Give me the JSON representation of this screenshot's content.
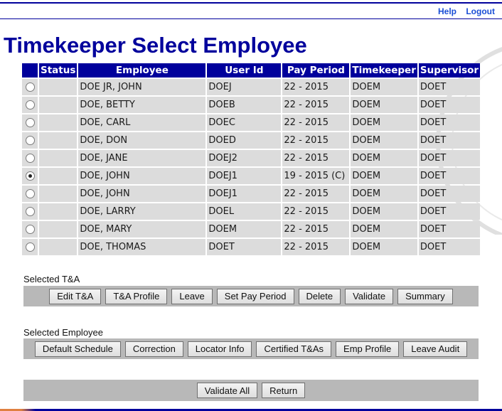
{
  "header": {
    "links": [
      {
        "label": "Help"
      },
      {
        "label": "Logout"
      }
    ],
    "title": "Timekeeper Select Employee"
  },
  "table": {
    "columns": [
      "",
      "Status",
      "Employee",
      "User Id",
      "Pay Period",
      "Timekeeper",
      "Supervisor"
    ],
    "rows": [
      {
        "selected": false,
        "status": "",
        "employee": "DOE JR, JOHN",
        "user_id": "DOEJ",
        "pay_period": "22 - 2015",
        "timekeeper": "DOEM",
        "supervisor": "DOET"
      },
      {
        "selected": false,
        "status": "",
        "employee": "DOE, BETTY",
        "user_id": "DOEB",
        "pay_period": "22 - 2015",
        "timekeeper": "DOEM",
        "supervisor": "DOET"
      },
      {
        "selected": false,
        "status": "",
        "employee": "DOE, CARL",
        "user_id": "DOEC",
        "pay_period": "22 - 2015",
        "timekeeper": "DOEM",
        "supervisor": "DOET"
      },
      {
        "selected": false,
        "status": "",
        "employee": "DOE, DON",
        "user_id": "DOED",
        "pay_period": "22 - 2015",
        "timekeeper": "DOEM",
        "supervisor": "DOET"
      },
      {
        "selected": false,
        "status": "",
        "employee": "DOE, JANE",
        "user_id": "DOEJ2",
        "pay_period": "22 - 2015",
        "timekeeper": "DOEM",
        "supervisor": "DOET"
      },
      {
        "selected": true,
        "status": "",
        "employee": "DOE, JOHN",
        "user_id": "DOEJ1",
        "pay_period": "19 - 2015 (C)",
        "timekeeper": "DOEM",
        "supervisor": "DOET"
      },
      {
        "selected": false,
        "status": "",
        "employee": "DOE, JOHN",
        "user_id": "DOEJ1",
        "pay_period": "22 - 2015",
        "timekeeper": "DOEM",
        "supervisor": "DOET"
      },
      {
        "selected": false,
        "status": "",
        "employee": "DOE, LARRY",
        "user_id": "DOEL",
        "pay_period": "22 - 2015",
        "timekeeper": "DOEM",
        "supervisor": "DOET"
      },
      {
        "selected": false,
        "status": "",
        "employee": "DOE, MARY",
        "user_id": "DOEM",
        "pay_period": "22 - 2015",
        "timekeeper": "DOEM",
        "supervisor": "DOET"
      },
      {
        "selected": false,
        "status": "",
        "employee": "DOE, THOMAS",
        "user_id": "DOET",
        "pay_period": "22 - 2015",
        "timekeeper": "DOEM",
        "supervisor": "DOET"
      }
    ]
  },
  "selected_ta": {
    "label": "Selected T&A",
    "buttons": [
      "Edit T&A",
      "T&A Profile",
      "Leave",
      "Set Pay Period",
      "Delete",
      "Validate",
      "Summary"
    ]
  },
  "selected_employee": {
    "label": "Selected Employee",
    "buttons": [
      "Default Schedule",
      "Correction",
      "Locator Info",
      "Certified T&As",
      "Emp Profile",
      "Leave Audit"
    ]
  },
  "footer": {
    "buttons": [
      "Validate All",
      "Return"
    ]
  }
}
